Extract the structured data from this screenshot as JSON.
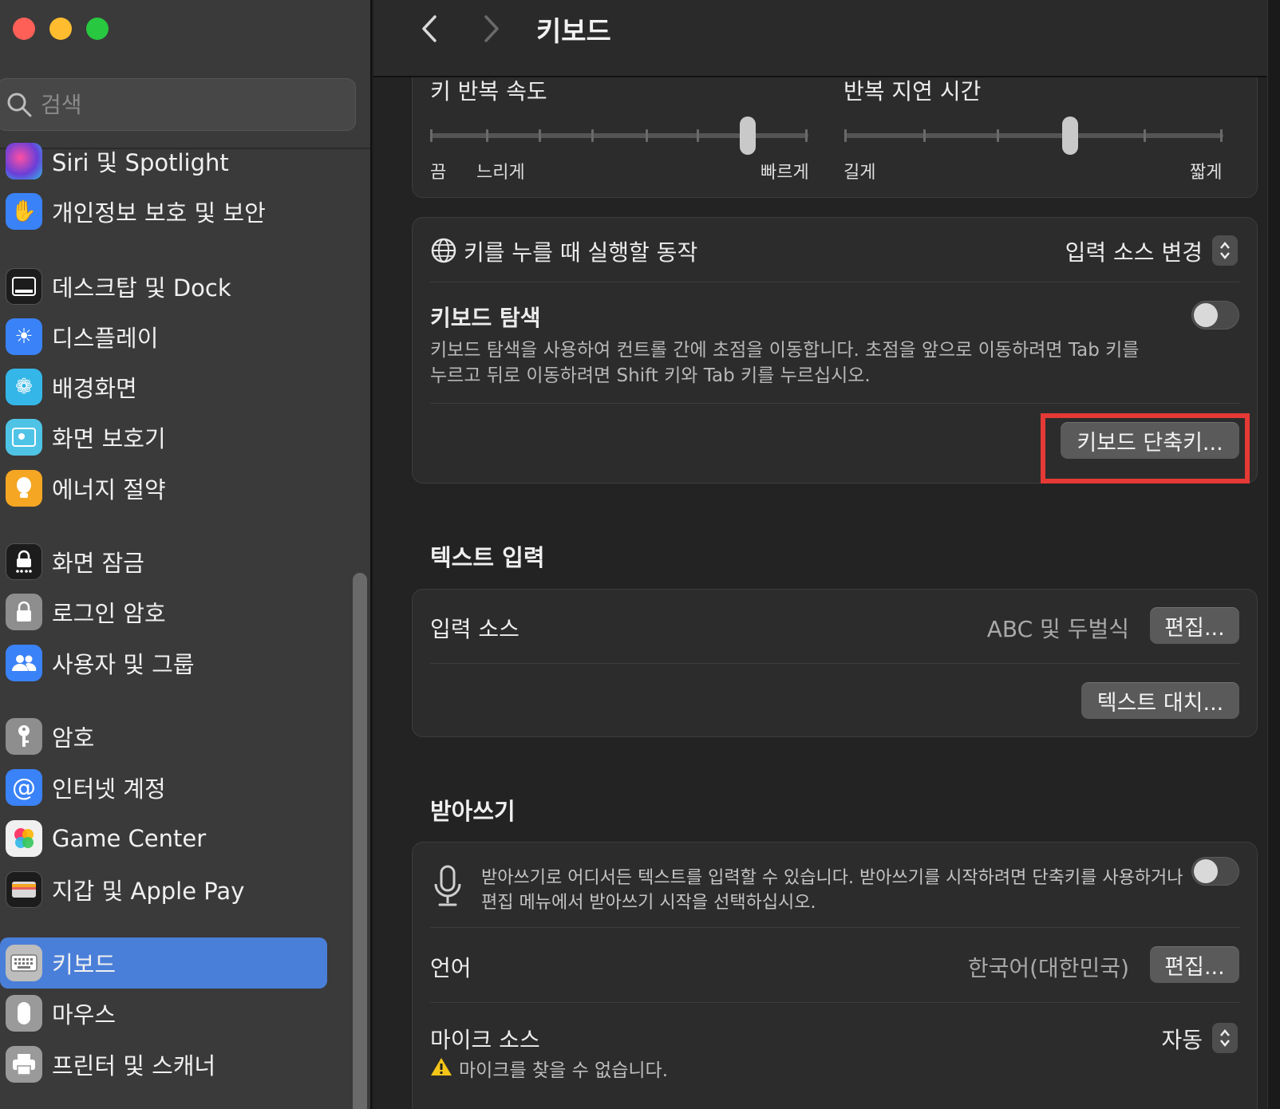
{
  "window": {
    "title": "키보드"
  },
  "search": {
    "placeholder": "검색"
  },
  "sidebar": {
    "items": [
      {
        "label": "Siri 및 Spotlight",
        "icon": "siri-icon",
        "color": "#6a3fd8"
      },
      {
        "label": "개인정보 보호 및 보안",
        "icon": "hand-icon",
        "color": "#3a82f7"
      },
      {
        "label": "데스크탑 및 Dock",
        "icon": "dock-icon",
        "color": "#1c1c1c"
      },
      {
        "label": "디스플레이",
        "icon": "sun-icon",
        "color": "#3a82f7"
      },
      {
        "label": "배경화면",
        "icon": "flower-icon",
        "color": "#35b6e8"
      },
      {
        "label": "화면 보호기",
        "icon": "screensaver-icon",
        "color": "#4fc3e6"
      },
      {
        "label": "에너지 절약",
        "icon": "lightbulb-icon",
        "color": "#f5a623"
      },
      {
        "label": "화면 잠금",
        "icon": "lock-screen-icon",
        "color": "#1c1c1c"
      },
      {
        "label": "로그인 암호",
        "icon": "lock-icon",
        "color": "#8e8e8e"
      },
      {
        "label": "사용자 및 그룹",
        "icon": "users-icon",
        "color": "#3a82f7"
      },
      {
        "label": "암호",
        "icon": "key-icon",
        "color": "#8e8e8e"
      },
      {
        "label": "인터넷 계정",
        "icon": "at-icon",
        "color": "#3a82f7"
      },
      {
        "label": "Game Center",
        "icon": "game-center-icon",
        "color": "#f0f0f0"
      },
      {
        "label": "지갑 및 Apple Pay",
        "icon": "wallet-icon",
        "color": "#1c1c1c"
      },
      {
        "label": "키보드",
        "icon": "keyboard-icon",
        "color": "#9a9a9a",
        "active": true
      },
      {
        "label": "마우스",
        "icon": "mouse-icon",
        "color": "#9a9a9a"
      },
      {
        "label": "프린터 및 스캐너",
        "icon": "printer-icon",
        "color": "#9a9a9a"
      }
    ]
  },
  "key_repeat": {
    "rate_label": "키 반복 속도",
    "rate_off": "끔",
    "rate_slow": "느리게",
    "rate_fast": "빠르게",
    "rate_level": 0.85,
    "delay_label": "반복 지연 시간",
    "delay_long": "길게",
    "delay_short": "짧게",
    "delay_level": 0.6
  },
  "globe_key": {
    "label": "키를 누를 때 실행할 동작",
    "value": "입력 소스 변경"
  },
  "keyboard_nav": {
    "title": "키보드 탐색",
    "description_line1": "키보드 탐색을 사용하여 컨트롤 간에 초점을 이동합니다. 초점을 앞으로 이동하려면 Tab 키를",
    "description_line2": "누르고 뒤로 이동하려면 Shift 키와 Tab 키를 누르십시오.",
    "enabled": false,
    "shortcuts_button": "키보드 단축키..."
  },
  "text_input": {
    "heading": "텍스트 입력",
    "input_sources_label": "입력 소스",
    "input_sources_value": "ABC 및 두벌식",
    "edit_button": "편집...",
    "text_replace_button": "텍스트 대치..."
  },
  "dictation": {
    "heading": "받아쓰기",
    "description_line1": "받아쓰기로 어디서든 텍스트를 입력할 수 있습니다. 받아쓰기를 시작하려면 단축키를 사용하거나",
    "description_line2": "편집 메뉴에서 받아쓰기 시작을 선택하십시오.",
    "enabled": false,
    "language_label": "언어",
    "language_value": "한국어(대한민국)",
    "language_edit_button": "편집...",
    "mic_label": "마이크 소스",
    "mic_value": "자동",
    "mic_warning": "마이크를 찾을 수 없습니다."
  }
}
